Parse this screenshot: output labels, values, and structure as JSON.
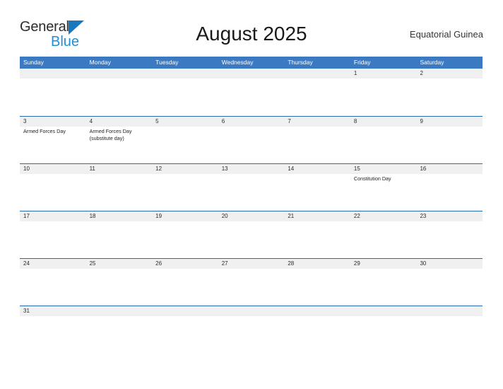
{
  "brand": {
    "name_part1": "General",
    "name_part2": "Blue",
    "flag_icon": "triangle-flag-icon",
    "color_dark": "#2b2b2b",
    "color_blue": "#1f8fd6",
    "flag_color": "#1878bd"
  },
  "header": {
    "title": "August 2025",
    "country": "Equatorial Guinea"
  },
  "theme": {
    "header_bar": "#3b7ac2",
    "row_divider": "#2a6aae",
    "number_band": "#f0f0f0",
    "page_background": "#ffffff",
    "text": "#222222"
  },
  "calendar": {
    "weekdays": [
      "Sunday",
      "Monday",
      "Tuesday",
      "Wednesday",
      "Thursday",
      "Friday",
      "Saturday"
    ],
    "weeks": [
      {
        "days": [
          {
            "number": "",
            "events": []
          },
          {
            "number": "",
            "events": []
          },
          {
            "number": "",
            "events": []
          },
          {
            "number": "",
            "events": []
          },
          {
            "number": "",
            "events": []
          },
          {
            "number": "1",
            "events": []
          },
          {
            "number": "2",
            "events": []
          }
        ]
      },
      {
        "days": [
          {
            "number": "3",
            "events": [
              "Armed Forces Day"
            ]
          },
          {
            "number": "4",
            "events": [
              "Armed Forces Day (substitute day)"
            ]
          },
          {
            "number": "5",
            "events": []
          },
          {
            "number": "6",
            "events": []
          },
          {
            "number": "7",
            "events": []
          },
          {
            "number": "8",
            "events": []
          },
          {
            "number": "9",
            "events": []
          }
        ]
      },
      {
        "days": [
          {
            "number": "10",
            "events": []
          },
          {
            "number": "11",
            "events": []
          },
          {
            "number": "12",
            "events": []
          },
          {
            "number": "13",
            "events": []
          },
          {
            "number": "14",
            "events": []
          },
          {
            "number": "15",
            "events": [
              "Constitution Day"
            ]
          },
          {
            "number": "16",
            "events": []
          }
        ]
      },
      {
        "days": [
          {
            "number": "17",
            "events": []
          },
          {
            "number": "18",
            "events": []
          },
          {
            "number": "19",
            "events": []
          },
          {
            "number": "20",
            "events": []
          },
          {
            "number": "21",
            "events": []
          },
          {
            "number": "22",
            "events": []
          },
          {
            "number": "23",
            "events": []
          }
        ]
      },
      {
        "days": [
          {
            "number": "24",
            "events": []
          },
          {
            "number": "25",
            "events": []
          },
          {
            "number": "26",
            "events": []
          },
          {
            "number": "27",
            "events": []
          },
          {
            "number": "28",
            "events": []
          },
          {
            "number": "29",
            "events": []
          },
          {
            "number": "30",
            "events": []
          }
        ]
      },
      {
        "days": [
          {
            "number": "31",
            "events": []
          },
          {
            "number": "",
            "events": []
          },
          {
            "number": "",
            "events": []
          },
          {
            "number": "",
            "events": []
          },
          {
            "number": "",
            "events": []
          },
          {
            "number": "",
            "events": []
          },
          {
            "number": "",
            "events": []
          }
        ]
      }
    ]
  }
}
